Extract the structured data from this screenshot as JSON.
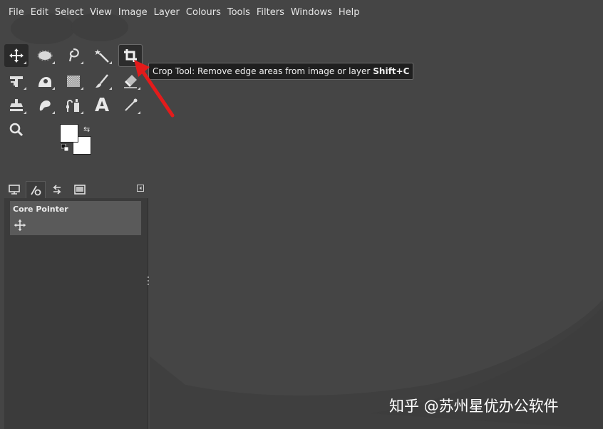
{
  "menubar": {
    "items": [
      "File",
      "Edit",
      "Select",
      "View",
      "Image",
      "Layer",
      "Colours",
      "Tools",
      "Filters",
      "Windows",
      "Help"
    ]
  },
  "toolbox": {
    "tools": [
      {
        "name": "move-tool-icon"
      },
      {
        "name": "ellipse-select-tool-icon"
      },
      {
        "name": "free-select-tool-icon"
      },
      {
        "name": "fuzzy-select-tool-icon"
      },
      {
        "name": "crop-tool-icon"
      },
      {
        "name": "unified-transform-tool-icon"
      },
      {
        "name": "warp-transform-tool-icon"
      },
      {
        "name": "blend-tool-icon"
      },
      {
        "name": "paintbrush-tool-icon"
      },
      {
        "name": "eraser-tool-icon"
      },
      {
        "name": "clone-tool-icon"
      },
      {
        "name": "smudge-tool-icon"
      },
      {
        "name": "paths-tool-icon"
      },
      {
        "name": "text-tool-icon"
      },
      {
        "name": "color-picker-tool-icon"
      },
      {
        "name": "zoom-tool-icon"
      }
    ],
    "text_tool_glyph": "A"
  },
  "colors": {
    "foreground": "#ffffff",
    "background": "#ffffff",
    "swap_glyph": "⇆"
  },
  "dock": {
    "tabs": [
      "device-status-icon",
      "tool-options-icon",
      "undo-history-icon",
      "images-icon"
    ],
    "device_status": {
      "label": "Core Pointer"
    }
  },
  "tooltip": {
    "text": "Crop Tool: Remove edge areas from image or layer",
    "shortcut": "Shift+C"
  },
  "watermark": {
    "text": "知乎 @苏州星优办公软件"
  },
  "theme": {
    "canvas_bg": "#454545",
    "panel_bg": "#3b3b3b",
    "accent_arrow": "#e31b1b"
  }
}
